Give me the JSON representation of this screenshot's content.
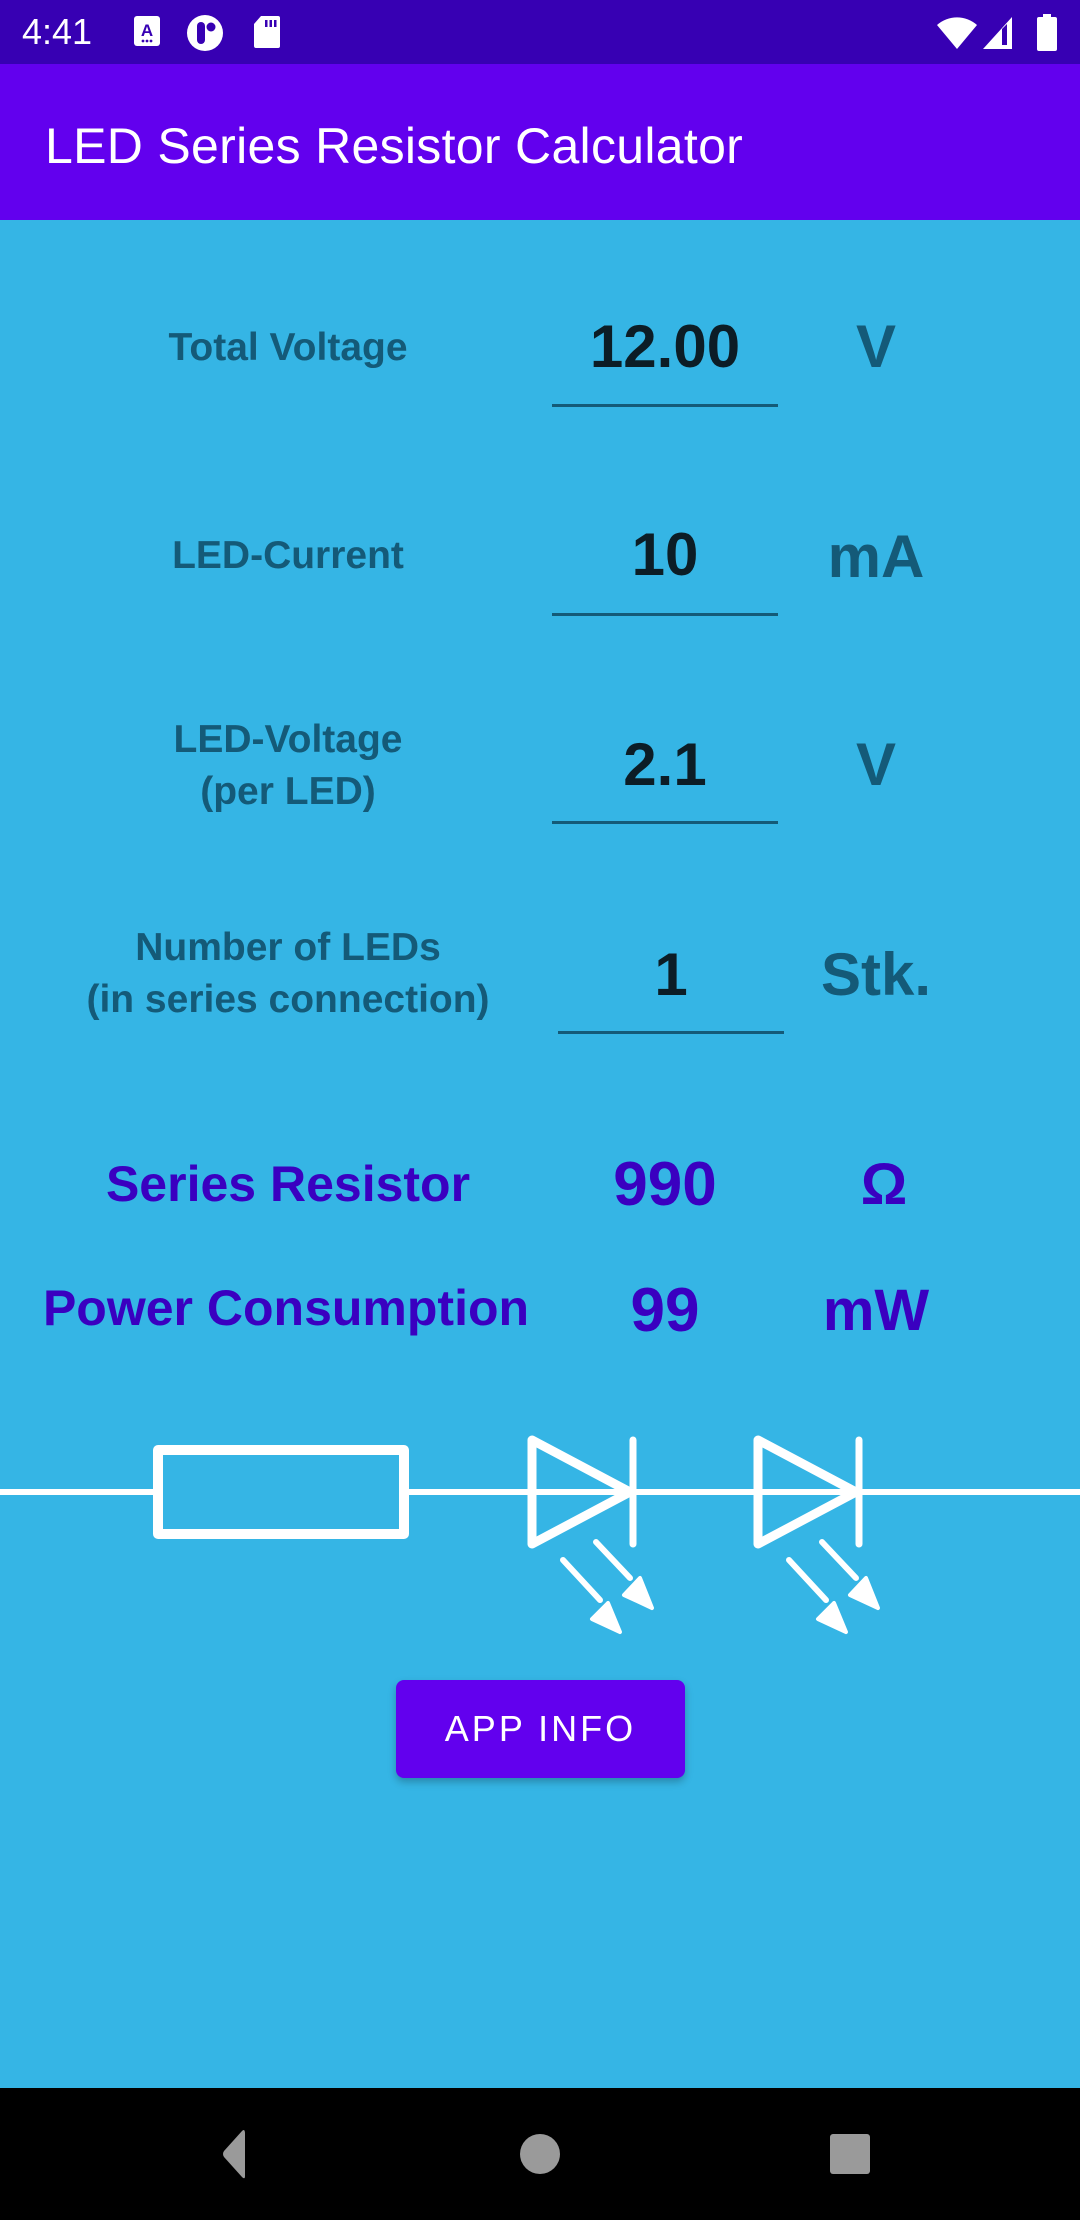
{
  "status_bar": {
    "time": "4:41",
    "left_icons": [
      "accessibility-a-icon",
      "circle-notification-icon",
      "sd-card-icon"
    ],
    "right_icons": [
      "wifi-icon",
      "cellular-signal-icon",
      "battery-icon"
    ]
  },
  "app_bar": {
    "title": "LED Series Resistor Calculator"
  },
  "colors": {
    "status_bar": "#3700b3",
    "app_bar": "#6200ee",
    "background": "#35b5e5",
    "label_text": "#145a78",
    "result_text": "#3a00c0",
    "button": "#6200ee"
  },
  "inputs": [
    {
      "label_line1": "Total Voltage",
      "label_line2": "",
      "value": "12.00",
      "unit": "V"
    },
    {
      "label_line1": "LED-Current",
      "label_line2": "",
      "value": "10",
      "unit": "mA"
    },
    {
      "label_line1": "LED-Voltage",
      "label_line2": "(per LED)",
      "value": "2.1",
      "unit": "V"
    },
    {
      "label_line1": "Number of LEDs",
      "label_line2": "(in series connection)",
      "value": "1",
      "unit": "Stk."
    }
  ],
  "results": [
    {
      "label": "Series Resistor",
      "value": "990",
      "unit": "Ω"
    },
    {
      "label": "Power Consumption",
      "value": "99",
      "unit": "mW"
    }
  ],
  "circuit": {
    "components": [
      "resistor",
      "led",
      "led"
    ]
  },
  "button": {
    "label": "APP INFO"
  },
  "nav_bar": {
    "buttons": [
      "back",
      "home",
      "recents"
    ]
  }
}
